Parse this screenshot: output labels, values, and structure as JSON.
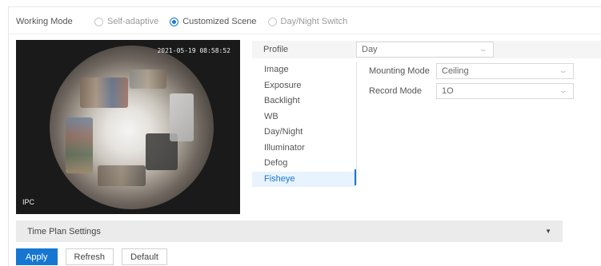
{
  "working_mode": {
    "label": "Working Mode",
    "options": [
      {
        "label": "Self-adaptive",
        "selected": false
      },
      {
        "label": "Customized Scene",
        "selected": true
      },
      {
        "label": "Day/Night Switch",
        "selected": false
      }
    ]
  },
  "video": {
    "timestamp": "2021-05-19 08:58:52",
    "channel": "IPC"
  },
  "profile": {
    "label": "Profile",
    "value": "Day"
  },
  "menu": {
    "items": [
      "Image",
      "Exposure",
      "Backlight",
      "WB",
      "Day/Night",
      "Illuminator",
      "Defog",
      "Fisheye"
    ],
    "active": "Fisheye"
  },
  "fisheye": {
    "mounting_mode": {
      "label": "Mounting Mode",
      "value": "Ceiling"
    },
    "record_mode": {
      "label": "Record Mode",
      "value": "1O"
    }
  },
  "time_plan": {
    "label": "Time Plan Settings"
  },
  "actions": {
    "apply": "Apply",
    "refresh": "Refresh",
    "default": "Default"
  },
  "colors": {
    "accent": "#1677d2",
    "active_menu_bg": "#e8f3fd",
    "section_bar_bg": "#ebebeb"
  }
}
